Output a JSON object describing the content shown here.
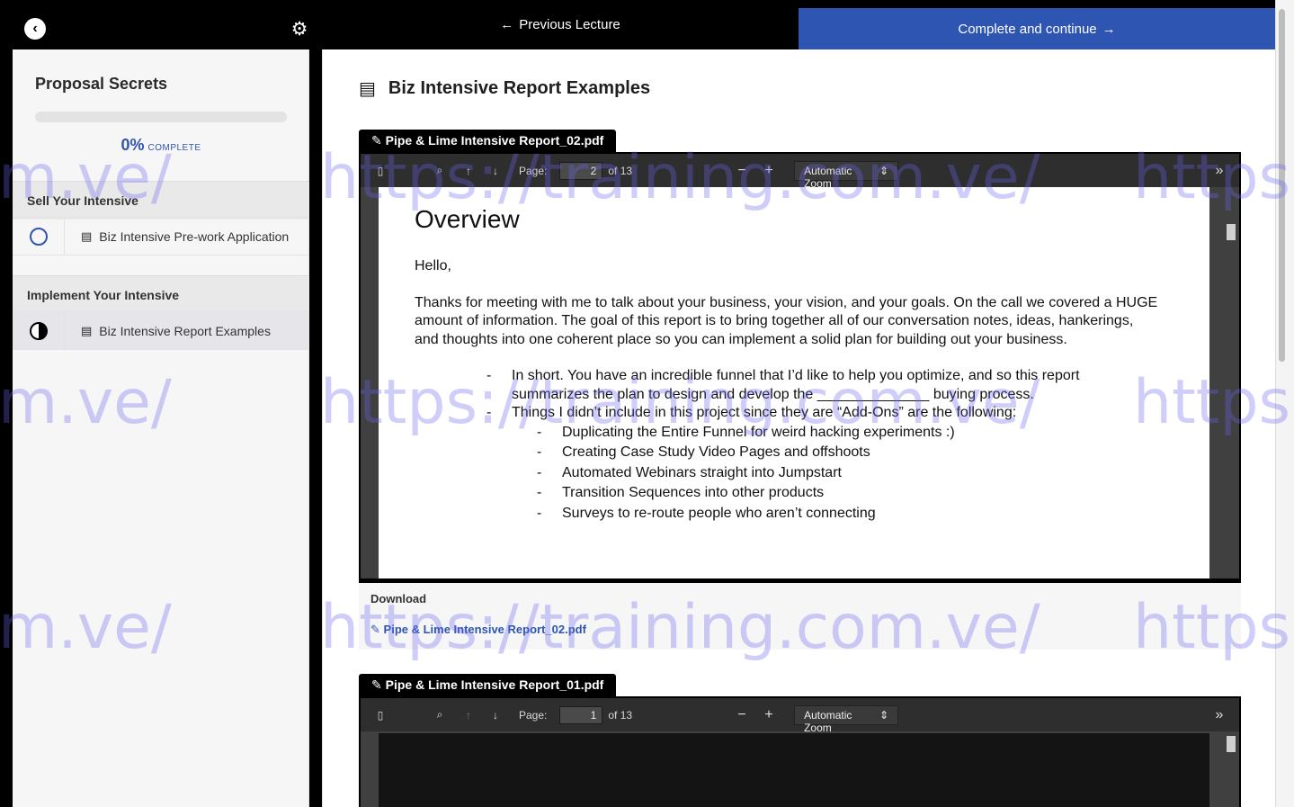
{
  "topbar": {
    "back_icon": "chevron-left-icon",
    "settings_icon": "gear-icon",
    "prev_lecture": "Previous Lecture",
    "complete_continue": "Complete and continue",
    "accent_color": "#2f55b2"
  },
  "sidebar": {
    "course_title": "Proposal Secrets",
    "progress_percent": "0%",
    "progress_value": 0,
    "progress_label": "COMPLETE",
    "sections": [
      {
        "title": "Sell Your Intensive",
        "lectures": [
          {
            "label": "Biz Intensive Pre-work Application",
            "status": "not-started"
          }
        ]
      },
      {
        "title": "Implement Your Intensive",
        "lectures": [
          {
            "label": "Biz Intensive Report Examples",
            "status": "in-progress"
          }
        ]
      }
    ]
  },
  "main": {
    "lecture_title": "Biz Intensive Report Examples",
    "pdf1": {
      "filename": "Pipe & Lime Intensive Report_02.pdf",
      "page_label": "Page:",
      "page_value": "2",
      "page_of": "of 13",
      "zoom": "Automatic Zoom",
      "doc": {
        "heading": "Overview",
        "greeting": "Hello,",
        "paragraph": "Thanks for meeting with me to talk about your business, your vision, and your goals. On the call we covered a HUGE amount of information. The goal of this report is to bring together all of our conversation notes, ideas, hankerings, and thoughts into one coherent place so you can implement a solid plan for building out your business.",
        "bullet1_pre": "In short. You have an incredible funnel that I’d like to help you optimize, and so this report summarizes the plan to design and develop the",
        "bullet1_blank": "______________",
        "bullet1_post": "buying process.",
        "bullet2": "Things I didn’t include in this project since they are “Add-Ons” are the following:",
        "subbullets": [
          "Duplicating the Entire Funnel for weird hacking experiments :)",
          "Creating Case Study Video Pages and offshoots",
          "Automated Webinars straight into Jumpstart",
          "Transition Sequences into other products",
          "Surveys to re-route people who aren’t connecting"
        ]
      }
    },
    "download": {
      "heading": "Download",
      "link": "Pipe & Lime Intensive Report_02.pdf"
    },
    "pdf2": {
      "filename": "Pipe & Lime Intensive Report_01.pdf",
      "page_label": "Page:",
      "page_value": "1",
      "page_of": "of 13",
      "zoom": "Automatic Zoom"
    }
  },
  "watermark": {
    "text_full": "https://training.com.ve/",
    "text_left": "m.ve/",
    "text_right": "https:/"
  }
}
